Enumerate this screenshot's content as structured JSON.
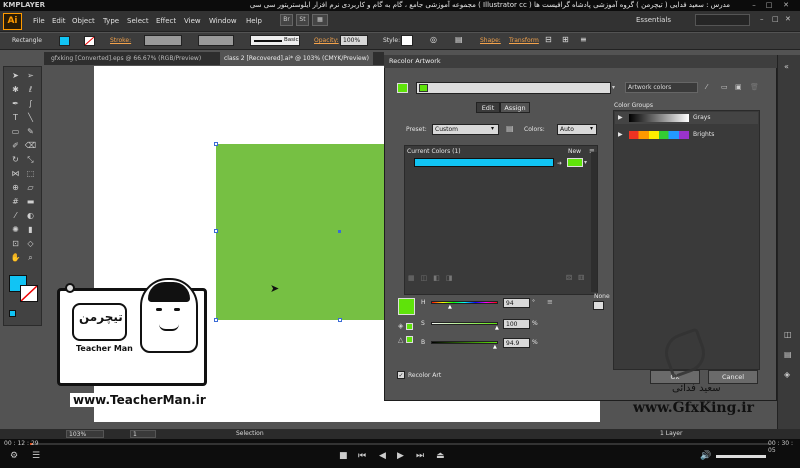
{
  "player": {
    "brand": "KMPLAYER",
    "title": "مجموعه آموزشی جامع ، گام به گام و کاربردی نرم افزار ایلوستریتور سی سی ( Illustrator cc )  مدرس : سعید فدایی ( تیچرمن ) گروه آموزشی پادشاه گرافیست ها",
    "time_elapsed": "00 : 12 : 29",
    "time_total": "00 : 30 : 05"
  },
  "app": {
    "logo": "Ai",
    "menu": [
      "File",
      "Edit",
      "Object",
      "Type",
      "Select",
      "Effect",
      "View",
      "Window",
      "Help"
    ],
    "app_icons": [
      "Br",
      "St"
    ],
    "workspace": "Essentials"
  },
  "control_bar": {
    "object_type": "Rectangle",
    "stroke_label": "Stroke:",
    "stroke_style": "Basic",
    "opacity_label": "Opacity:",
    "opacity_value": "100%",
    "style_label": "Style:",
    "shape_label": "Shape:",
    "transform_label": "Transform"
  },
  "doc_tabs": [
    {
      "label": "gfxking [Converted].eps @ 66.67% (RGB/Preview)"
    },
    {
      "label": "class 2 [Recovered].ai* @ 103% (CMYK/Preview)"
    }
  ],
  "recolor": {
    "title": "Recolor Artwork",
    "name_field": "Artwork colors",
    "tabs": [
      "Edit",
      "Assign"
    ],
    "preset_label": "Preset:",
    "preset_value": "Custom",
    "colors_label": "Colors:",
    "colors_value": "Auto",
    "current_colors_label": "Current Colors (1)",
    "new_label": "New",
    "color_groups_label": "Color Groups",
    "groups": [
      {
        "name": "Grays"
      },
      {
        "name": "Brights"
      }
    ],
    "hsb": {
      "h_label": "H",
      "h_value": "94",
      "h_unit": "°",
      "s_label": "S",
      "s_value": "100",
      "s_unit": "%",
      "b_label": "B",
      "b_value": "94.9",
      "b_unit": "%"
    },
    "none_label": "None",
    "recolor_art_label": "Recolor Art",
    "ok_label": "Ok",
    "cancel_label": "Cancel",
    "colors": {
      "current": "#11c4f4",
      "green": "#5fe30a",
      "artwork": "#76c043"
    }
  },
  "watermark": {
    "logo_fa": "تیچرمن",
    "logo_en": "Teacher Man",
    "url": "www.TeacherMan.ir",
    "gfx": "www.GfxKing.ir",
    "gfx_fa": "سعید فدائی"
  },
  "status": {
    "zoom": "103%",
    "page": "1",
    "tool": "Selection",
    "layers": "1 Layer"
  }
}
